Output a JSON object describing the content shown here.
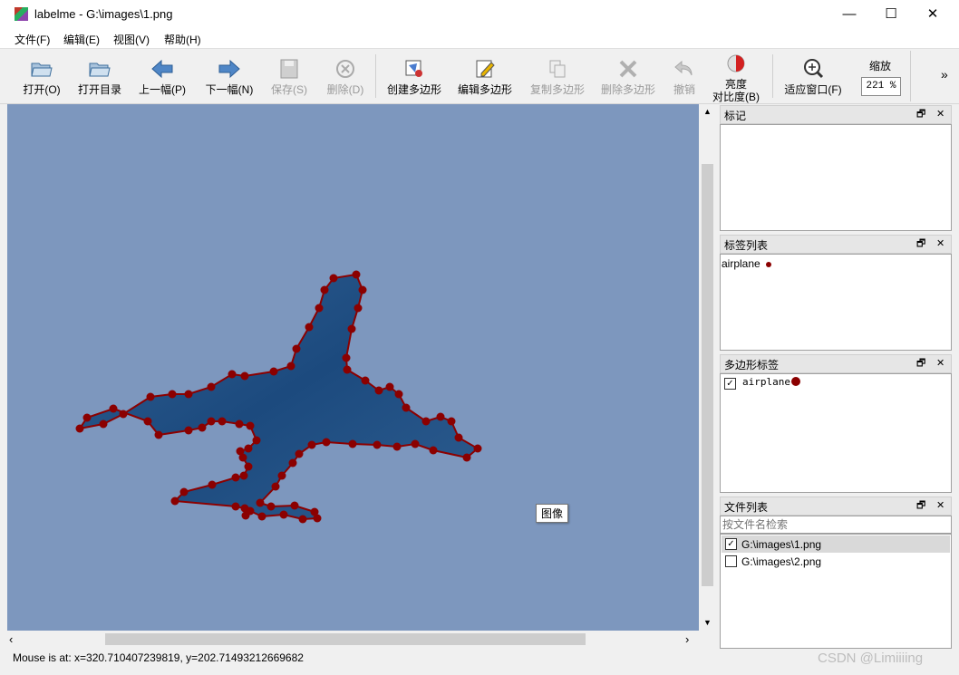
{
  "window": {
    "title": "labelme - G:\\images\\1.png",
    "minimize": "—",
    "maximize": "☐",
    "close": "✕"
  },
  "menu": [
    "文件(F)",
    "编辑(E)",
    "视图(V)",
    "帮助(H)"
  ],
  "toolbar": {
    "open": "打开(O)",
    "open_dir": "打开目录",
    "prev": "上一幅(P)",
    "next": "下一幅(N)",
    "save": "保存(S)",
    "delete": "删除(D)",
    "create_polygon": "创建多边形",
    "edit_polygon": "编辑多边形",
    "copy_polygon": "复制多边形",
    "delete_polygon": "删除多边形",
    "undo": "撤销",
    "brightness_l1": "亮度",
    "brightness_l2": "对比度(B)",
    "fit_window": "适应窗口(F)",
    "zoom_label": "缩放",
    "zoom_value": "221 %",
    "more": "»"
  },
  "canvas": {
    "tooltip": "图像"
  },
  "docks": {
    "flags": {
      "title": "标记"
    },
    "label_list": {
      "title": "标签列表",
      "items": [
        {
          "text": "airplane",
          "color": "#8b0000"
        }
      ]
    },
    "polygon_labels": {
      "title": "多边形标签",
      "items": [
        {
          "text": "airplane",
          "checked": true,
          "color": "#8b0000"
        }
      ]
    },
    "file_list": {
      "title": "文件列表",
      "search_placeholder": "按文件名检索",
      "files": [
        {
          "name": "G:\\images\\1.png",
          "checked": true
        },
        {
          "name": "G:\\images\\2.png",
          "checked": false
        }
      ]
    },
    "float_icon": "🗗",
    "close_icon": "✕"
  },
  "status": {
    "text": "Mouse is at: x=320.710407239819, y=202.71493212669682"
  },
  "watermark": "CSDN @Limiiiing",
  "colors": {
    "polygon": "#8b0000",
    "sky": "#7d97be"
  }
}
